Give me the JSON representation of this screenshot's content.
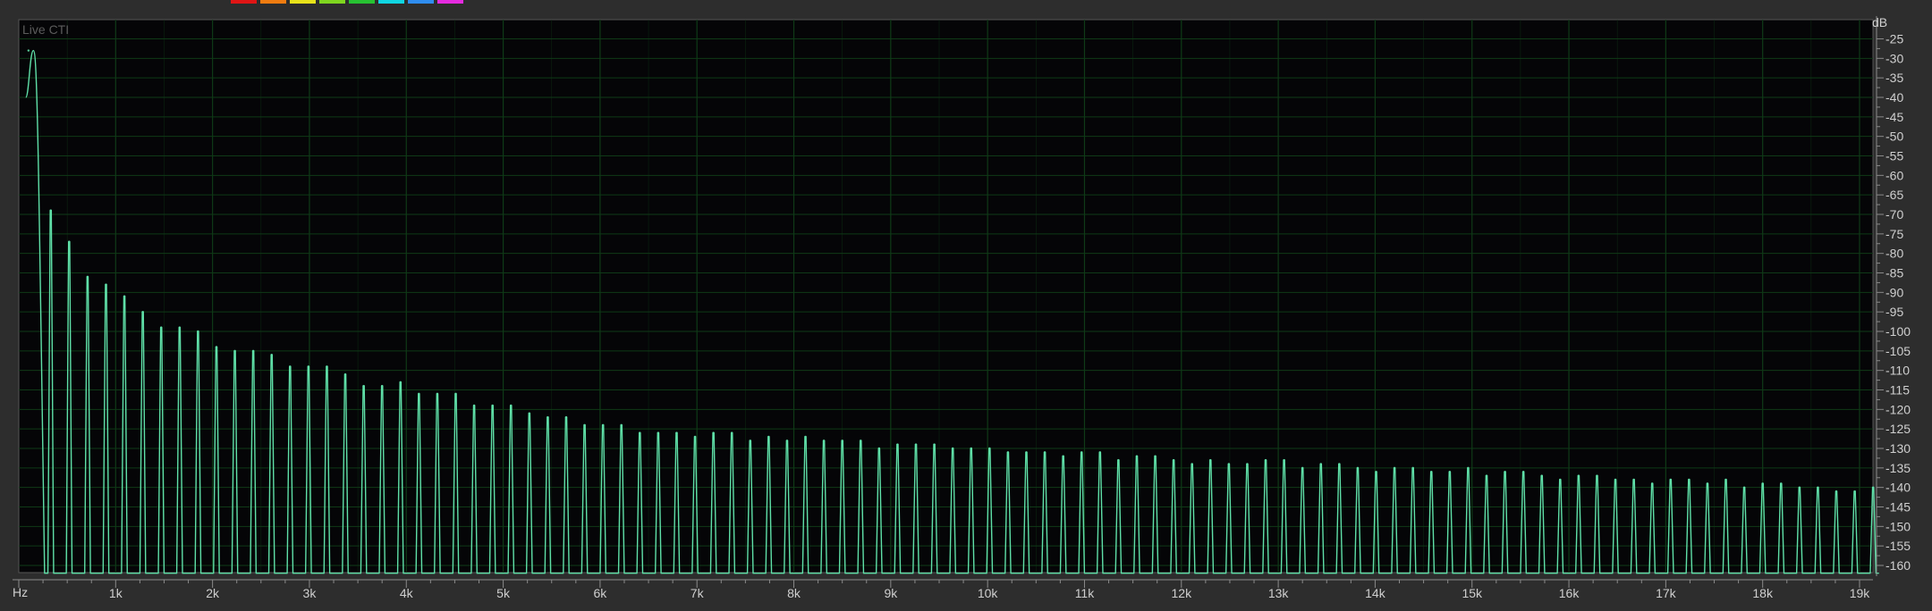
{
  "palette": {
    "swatches": [
      "#e01515",
      "#f07c10",
      "#e8e21a",
      "#7fd61f",
      "#27c232",
      "#10d6e2",
      "#2f8df0",
      "#e52be0"
    ],
    "plot_background": "#050507",
    "grid": "#0f3a17",
    "trace": "#5fe0a8",
    "panel": "#2d2d2d"
  },
  "chart_data": {
    "type": "line",
    "title": "",
    "panel_label": "Live CTI",
    "xlabel": "Hz",
    "ylabel": "dB",
    "x_unit_label": "Hz",
    "y_unit_label": "dB",
    "xlim": [
      0,
      19200
    ],
    "ylim": [
      -163,
      -22
    ],
    "x_ticks": [
      1000,
      2000,
      3000,
      4000,
      5000,
      6000,
      7000,
      8000,
      9000,
      10000,
      11000,
      12000,
      13000,
      14000,
      15000,
      16000,
      17000,
      18000,
      19000
    ],
    "x_tick_labels": [
      "1k",
      "2k",
      "3k",
      "4k",
      "5k",
      "6k",
      "7k",
      "8k",
      "9k",
      "10k",
      "11k",
      "12k",
      "13k",
      "14k",
      "15k",
      "16k",
      "17k",
      "18k",
      "19k"
    ],
    "y_ticks": [
      -25,
      -30,
      -35,
      -40,
      -45,
      -50,
      -55,
      -60,
      -65,
      -70,
      -75,
      -80,
      -85,
      -90,
      -95,
      -100,
      -105,
      -110,
      -115,
      -120,
      -125,
      -130,
      -135,
      -140,
      -145,
      -150,
      -155,
      -160
    ],
    "y_tick_labels": [
      "-25",
      "-30",
      "-35",
      "-40",
      "-45",
      "-50",
      "-55",
      "-60",
      "-65",
      "-70",
      "-75",
      "-80",
      "-85",
      "-90",
      "-95",
      "-100",
      "-105",
      "-110",
      "-115",
      "-120",
      "-125",
      "-130",
      "-135",
      "-140",
      "-145",
      "-150",
      "-155",
      "-160"
    ],
    "grid": true,
    "noise_floor_db": -162,
    "series": [
      {
        "peak_freq_hz": [
          100,
          330,
          520,
          710,
          900,
          1090,
          1280,
          1470,
          1660,
          1850,
          2040,
          2230,
          2420,
          2610,
          2800,
          2990,
          3180,
          3370,
          3560,
          3750,
          3940,
          4130,
          4320,
          4510,
          4700,
          4890,
          5080,
          5270,
          5460,
          5650,
          5840,
          6030,
          6220,
          6410,
          6600,
          6790,
          6980,
          7170,
          7360,
          7550,
          7740,
          7930,
          8120,
          8310,
          8500,
          8690,
          8880,
          9070,
          9260,
          9450,
          9640,
          9830,
          10020,
          10210,
          10400,
          10590,
          10780,
          10970,
          11160,
          11350,
          11540,
          11730,
          11920,
          12110,
          12300,
          12490,
          12680,
          12870,
          13060,
          13250,
          13440,
          13630,
          13820,
          14010,
          14200,
          14390,
          14580,
          14770,
          14960,
          15150,
          15340,
          15530,
          15720,
          15910,
          16100,
          16290,
          16480,
          16670,
          16860,
          17050,
          17240,
          17430,
          17620,
          17810,
          18000,
          18190,
          18380,
          18570,
          18760,
          18950,
          19140
        ],
        "peak_db": [
          -28,
          -69,
          -77,
          -86,
          -88,
          -91,
          -95,
          -99,
          -99,
          -100,
          -104,
          -105,
          -105,
          -106,
          -109,
          -109,
          -109,
          -111,
          -114,
          -114,
          -113,
          -116,
          -116,
          -116,
          -119,
          -119,
          -119,
          -121,
          -122,
          -122,
          -124,
          -124,
          -124,
          -126,
          -126,
          -126,
          -127,
          -126,
          -126,
          -128,
          -127,
          -128,
          -127,
          -128,
          -128,
          -128,
          -130,
          -129,
          -129,
          -129,
          -130,
          -130,
          -130,
          -131,
          -131,
          -131,
          -132,
          -131,
          -131,
          -133,
          -132,
          -132,
          -133,
          -134,
          -133,
          -134,
          -134,
          -133,
          -133,
          -135,
          -134,
          -134,
          -135,
          -136,
          -135,
          -135,
          -136,
          -136,
          -135,
          -137,
          -136,
          -136,
          -137,
          -138,
          -137,
          -137,
          -138,
          -138,
          -139,
          -138,
          -138,
          -139,
          -138,
          -140,
          -139,
          -139,
          -140,
          -140,
          -141,
          -141,
          -140
        ]
      }
    ]
  }
}
